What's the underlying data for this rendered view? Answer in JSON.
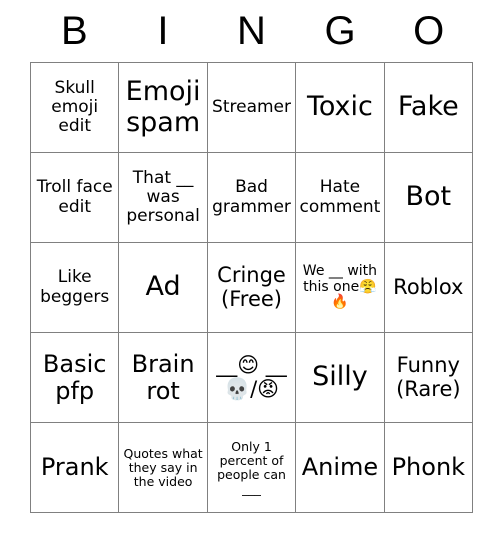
{
  "card": {
    "headers": [
      "B",
      "I",
      "N",
      "G",
      "O"
    ],
    "grid_color": "#808080",
    "text_color": "#000000",
    "background_color": "#ffffff",
    "rows": [
      [
        {
          "text": "Skull emoji edit",
          "size": "md"
        },
        {
          "text": "Emoji spam",
          "size": "xxl"
        },
        {
          "text": "Streamer",
          "size": "md"
        },
        {
          "text": "Toxic",
          "size": "xxl"
        },
        {
          "text": "Fake",
          "size": "xxl"
        }
      ],
      [
        {
          "text": "Troll face edit",
          "size": "md"
        },
        {
          "text": "That __ was personal",
          "size": "md"
        },
        {
          "text": "Bad grammer",
          "size": "md"
        },
        {
          "text": "Hate comment",
          "size": "md"
        },
        {
          "text": "Bot",
          "size": "xxl"
        }
      ],
      [
        {
          "text": "Like beggers",
          "size": "md"
        },
        {
          "text": "Ad",
          "size": "xxl"
        },
        {
          "text": "Cringe (Free)",
          "size": "lg"
        },
        {
          "text": "We __ with this one😤🔥",
          "size": "sm"
        },
        {
          "text": "Roblox",
          "size": "lg"
        }
      ],
      [
        {
          "text": "Basic pfp",
          "size": "xl"
        },
        {
          "text": "Brain rot",
          "size": "xl"
        },
        {
          "text": "__😊 __💀/😡",
          "size": "lg"
        },
        {
          "text": "Silly",
          "size": "xxl"
        },
        {
          "text": "Funny (Rare)",
          "size": "lg"
        }
      ],
      [
        {
          "text": "Prank",
          "size": "xl"
        },
        {
          "text": "Quotes what they say in the video",
          "size": "xs"
        },
        {
          "text": "Only 1 percent of people can ___",
          "size": "xs"
        },
        {
          "text": "Anime",
          "size": "xl"
        },
        {
          "text": "Phonk",
          "size": "xl"
        }
      ]
    ]
  }
}
